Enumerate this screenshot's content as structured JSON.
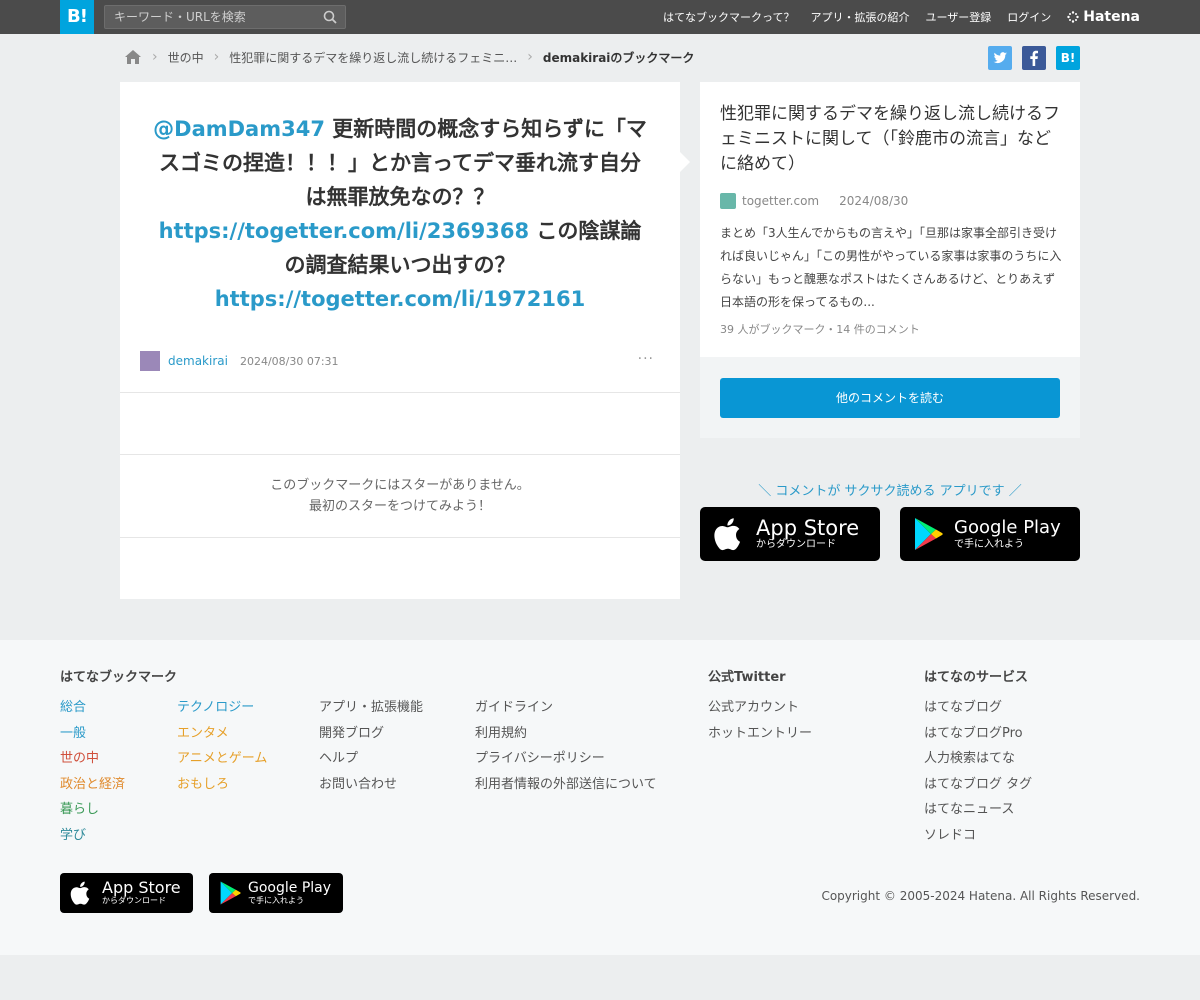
{
  "topbar": {
    "logo": "B!",
    "search_placeholder": "キーワード・URLを検索",
    "nav": [
      "はてなブックマークって？",
      "アプリ・拡張の紹介",
      "ユーザー登録",
      "ログイン"
    ],
    "brand": "Hatena"
  },
  "breadcrumb": {
    "items": [
      "世の中",
      "性犯罪に関するデマを繰り返し流し続けるフェミニ…"
    ],
    "current": "demakiraiのブックマーク"
  },
  "comment": {
    "mention": "@DamDam347",
    "text1": " 更新時間の概念すら知らずに「マスゴミの捏造！！！」とか言ってデマ垂れ流す自分は無罪放免なの？？",
    "link1": "https://togetter.com/li/2369368",
    "text2": " この陰謀論の調査結果いつ出すの？",
    "link2": "https://togetter.com/li/1972161",
    "username": "demakirai",
    "datetime": "2024/08/30 07:31",
    "more": "···",
    "no_star_line1": "このブックマークにはスターがありません。",
    "no_star_line2": "最初のスターをつけてみよう！"
  },
  "entry": {
    "title": "性犯罪に関するデマを繰り返し流し続けるフェミニストに関して（「鈴鹿市の流言」などに絡めて）",
    "domain": "togetter.com",
    "date": "2024/08/30",
    "description": "まとめ「3人生んでからもの言えや」「旦那は家事全部引き受ければ良いじゃん」「この男性がやっている家事は家事のうちに入らない」もっと醜悪なポストはたくさんあるけど、とりあえず日本語の形を保ってるもの...",
    "stats": "39 人がブックマーク・14 件のコメント",
    "read_button": "他のコメントを読む"
  },
  "promo": {
    "text": "＼ コメントが サクサク読める アプリです ／",
    "appstore_big": "App Store",
    "appstore_small": "からダウンロード",
    "googleplay_big": "Google Play",
    "googleplay_small": "で手に入れよう"
  },
  "footer": {
    "col1_head": "はてなブックマーク",
    "categories_a": [
      {
        "label": "総合",
        "color": "#2a9ac9"
      },
      {
        "label": "一般",
        "color": "#2a9ac9"
      },
      {
        "label": "世の中",
        "color": "#d04f3b"
      },
      {
        "label": "政治と経済",
        "color": "#e08a2c"
      },
      {
        "label": "暮らし",
        "color": "#3b9a58"
      },
      {
        "label": "学び",
        "color": "#2e8a9a"
      }
    ],
    "categories_b": [
      {
        "label": "テクノロジー",
        "color": "#2a9ac9"
      },
      {
        "label": "エンタメ",
        "color": "#e6a02a"
      },
      {
        "label": "アニメとゲーム",
        "color": "#e6a02a"
      },
      {
        "label": "おもしろ",
        "color": "#e6a02a"
      }
    ],
    "links_c": [
      "アプリ・拡張機能",
      "開発ブログ",
      "ヘルプ",
      "お問い合わせ"
    ],
    "links_d": [
      "ガイドライン",
      "利用規約",
      "プライバシーポリシー",
      "利用者情報の外部送信について"
    ],
    "twitter_head": "公式Twitter",
    "twitter_links": [
      "公式アカウント",
      "ホットエントリー"
    ],
    "services_head": "はてなのサービス",
    "services": [
      "はてなブログ",
      "はてなブログPro",
      "人力検索はてな",
      "はてなブログ タグ",
      "はてなニュース",
      "ソレドコ"
    ],
    "copyright": "Copyright © 2005-2024 Hatena. All Rights Reserved."
  }
}
